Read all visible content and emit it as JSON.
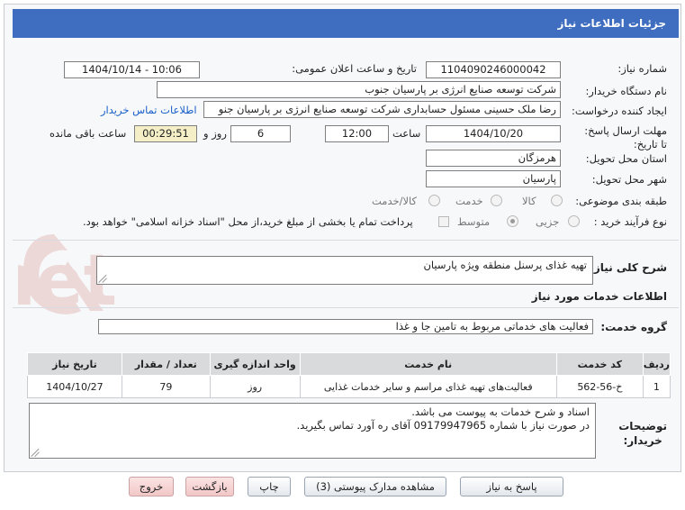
{
  "header": {
    "title": "جزئیات اطلاعات نیاز"
  },
  "fields": {
    "need_number_label": "شماره نیاز:",
    "need_number": "1104090246000042",
    "announce_label": "تاریخ و ساعت اعلان عمومی:",
    "announce_value": "1404/10/14 - 10:06",
    "buyer_org_label": "نام دستگاه خریدار:",
    "buyer_org": "شرکت توسعه صنایع انرژی بر پارسیان جنوب",
    "requester_label": "ایجاد کننده درخواست:",
    "requester": "رضا ملک حسینی مسئول حسابداری شرکت توسعه صنایع انرژی بر پارسیان جنو",
    "contact_link": "اطلاعات تماس خریدار",
    "deadline_label": "مهلت ارسال پاسخ: تا تاریخ:",
    "deadline_date": "1404/10/20",
    "time_label": "ساعت",
    "deadline_time": "12:00",
    "days": "6",
    "days_label": "روز و",
    "remaining": "00:29:51",
    "remaining_label": "ساعت باقی مانده",
    "province_label": "استان محل تحویل:",
    "province": "هرمزگان",
    "city_label": "شهر محل تحویل:",
    "city": "پارسیان",
    "category_label": "طبقه بندی موضوعی:",
    "category_options": [
      "کالا",
      "خدمت",
      "کالا/خدمت"
    ],
    "process_label": "نوع فرآیند خرید :",
    "process_options": [
      "جزیی",
      "متوسط"
    ],
    "payment_note": "پرداخت تمام یا بخشی از مبلغ خرید،از محل \"اسناد خزانه اسلامی\" خواهد بود."
  },
  "summary": {
    "label": "شرح کلی نیاز:",
    "value": "تهیه غذای پرسنل منطقه ویژه پارسیان"
  },
  "services": {
    "title": "اطلاعات خدمات مورد نیاز",
    "group_label": "گروه خدمت:",
    "group_value": "فعالیت های خدماتی مربوط به تامین جا و غذا",
    "columns": [
      "ردیف",
      "کد خدمت",
      "نام خدمت",
      "واحد اندازه گیری",
      "تعداد / مقدار",
      "تاریخ نیاز"
    ],
    "rows": [
      [
        "1",
        "خ-56-562",
        "فعالیت‌های تهیه غذای مراسم و سایر خدمات غذایی",
        "روز",
        "79",
        "1404/10/27"
      ]
    ]
  },
  "buyer_notes": {
    "label_line1": "توضیحات",
    "label_line2": "خریدار:",
    "line1": "اسناد و شرح خدمات به پیوست می باشد.",
    "line2": "در صورت نیاز با شماره 09179947965 آقای ره آورد تماس بگیرید."
  },
  "buttons": {
    "reply": "پاسخ به نیاز",
    "attachments": "مشاهده مدارک پیوستی (3)",
    "print": "چاپ",
    "back": "بازگشت",
    "exit": "خروج"
  },
  "watermark": {
    "text": "AriaTender.net"
  },
  "colors": {
    "header_bg": "#3f6ec0",
    "highlight": "#f4efc7",
    "link": "#1a5fc8",
    "watermark": "#c0392b"
  }
}
